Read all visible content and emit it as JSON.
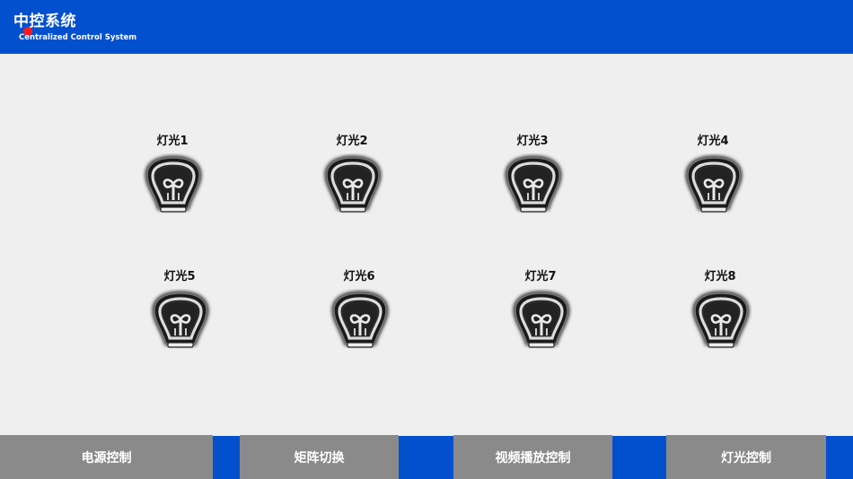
{
  "header": {
    "title": "中控系统",
    "subtitle": "Centralized Control System",
    "status_dot_color": "#ff1a1a"
  },
  "lights": [
    {
      "label": "灯光1",
      "icon": "light-bulb-icon"
    },
    {
      "label": "灯光2",
      "icon": "light-bulb-icon"
    },
    {
      "label": "灯光3",
      "icon": "light-bulb-icon"
    },
    {
      "label": "灯光4",
      "icon": "light-bulb-icon"
    },
    {
      "label": "灯光5",
      "icon": "light-bulb-icon"
    },
    {
      "label": "灯光6",
      "icon": "light-bulb-icon"
    },
    {
      "label": "灯光7",
      "icon": "light-bulb-icon"
    },
    {
      "label": "灯光8",
      "icon": "light-bulb-icon"
    }
  ],
  "bottom_nav": [
    {
      "label": "电源控制"
    },
    {
      "label": "矩阵切换"
    },
    {
      "label": "视频播放控制"
    },
    {
      "label": "灯光控制"
    }
  ],
  "colors": {
    "primary": "#0350cf",
    "nav_button": "#8a8a8a",
    "background": "#efefef"
  }
}
